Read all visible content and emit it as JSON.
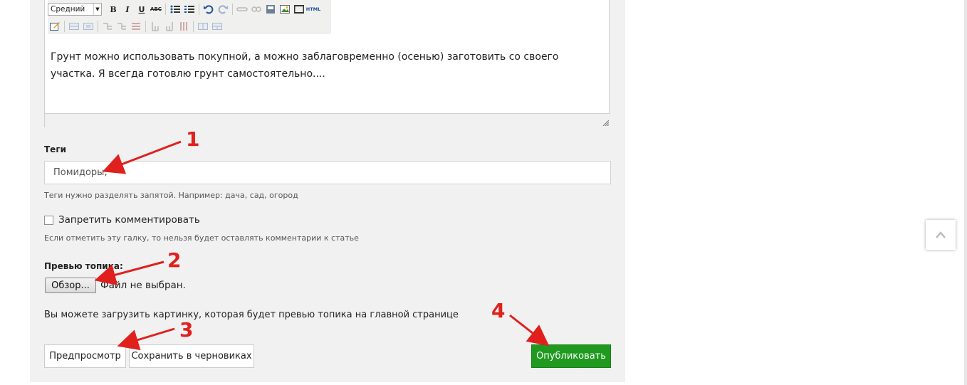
{
  "editor": {
    "format_select": "Средний",
    "toolbar_row1": [
      {
        "name": "bold-icon",
        "glyph": "B"
      },
      {
        "name": "italic-icon",
        "glyph": "I"
      },
      {
        "name": "underline-icon",
        "glyph": "U"
      },
      {
        "name": "strikethrough-icon",
        "glyph": "ABC"
      },
      {
        "name": "bullet-list-icon",
        "glyph": "≣"
      },
      {
        "name": "numbered-list-icon",
        "glyph": "≣"
      },
      {
        "name": "undo-icon",
        "glyph": "↶"
      },
      {
        "name": "redo-icon",
        "glyph": "↷"
      },
      {
        "name": "link-icon",
        "glyph": "⊃"
      },
      {
        "name": "unlink-icon",
        "glyph": "⊄"
      },
      {
        "name": "media-icon",
        "glyph": "▤"
      },
      {
        "name": "image-icon",
        "glyph": "▣"
      },
      {
        "name": "horizontal-rule-icon",
        "glyph": "⎯"
      },
      {
        "name": "html-icon",
        "glyph": "HTML"
      }
    ],
    "content": "Грунт можно использовать покупной, а можно заблаговременно (осенью) заготовить со своего участка. Я всегда готовлю грунт самостоятельно...."
  },
  "tags": {
    "label": "Теги",
    "value": "Помидоры,",
    "hint": "Теги нужно разделять запятой. Например: дача, сад, огород"
  },
  "comments": {
    "checkbox_label": "Запретить комментировать",
    "checked": false,
    "hint": "Если отметить эту галку, то нельзя будет оставлять комментарии к статье"
  },
  "preview": {
    "label": "Превью топика:",
    "browse_label": "Обзор...",
    "file_status": "Файл не выбран.",
    "note": "Вы можете загрузить картинку, которая будет превью топика на главной странице"
  },
  "actions": {
    "preview_label": "Предпросмотр",
    "save_draft_label": "Сохранить в черновиках",
    "publish_label": "Опубликовать",
    "publish_color": "#1f9a1f"
  },
  "annotations": {
    "color": "#e0201d",
    "marks": [
      "1",
      "2",
      "3",
      "4"
    ]
  },
  "scroll_top_icon": "chevron-up-icon"
}
